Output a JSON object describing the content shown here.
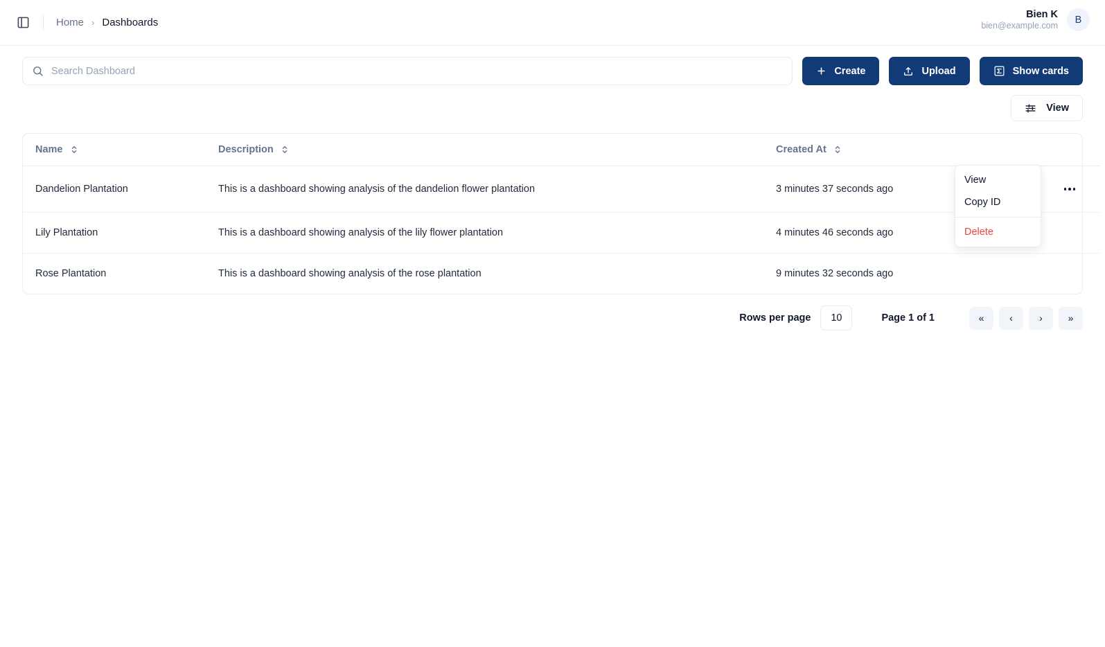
{
  "topbar": {
    "sidebar_toggle_icon": "panel-toggle-icon",
    "breadcrumb": {
      "home": "Home",
      "separator": "›",
      "current": "Dashboards"
    },
    "user": {
      "name": "Bien K",
      "email": "bien@example.com",
      "avatar_initial": "B"
    }
  },
  "toolbar": {
    "search": {
      "value": "",
      "placeholder": "Search Dashboard",
      "icon": "search-icon"
    },
    "create_label": "Create",
    "create_icon": "plus-icon",
    "upload_label": "Upload",
    "upload_icon": "upload-icon",
    "show_cards_label": "Show cards",
    "show_cards_icon": "sigma-box-icon",
    "view_label": "View",
    "view_icon": "sliders-icon"
  },
  "table": {
    "columns": [
      {
        "label": "Name",
        "sort_icon": "sort-chevrons-icon"
      },
      {
        "label": "Description",
        "sort_icon": "sort-chevrons-icon"
      },
      {
        "label": "Created At",
        "sort_icon": "sort-chevrons-icon"
      }
    ],
    "rows": [
      {
        "name": "Dandelion Plantation",
        "description": "This is a dashboard showing analysis of the dandelion flower plantation",
        "created_at": "3 minutes 37 seconds ago"
      },
      {
        "name": "Lily Plantation",
        "description": "This is a dashboard showing analysis of the lily flower plantation",
        "created_at": "4 minutes 46 seconds ago"
      },
      {
        "name": "Rose Plantation",
        "description": "This is a dashboard showing analysis of the rose plantation",
        "created_at": "9 minutes 32 seconds ago"
      }
    ]
  },
  "row_menu": {
    "view": "View",
    "copy_id": "Copy ID",
    "delete": "Delete"
  },
  "pagination": {
    "rows_per_page_label": "Rows per page",
    "rows_per_page_value": "10",
    "page_label": "Page 1 of 1",
    "first_icon": "«",
    "prev_icon": "‹",
    "next_icon": "›",
    "last_icon": "»"
  },
  "colors": {
    "primary": "#123a77",
    "danger": "#ef4444",
    "muted": "#64748b",
    "border": "#e9edf2",
    "avatar_bg": "#eff3fb"
  }
}
